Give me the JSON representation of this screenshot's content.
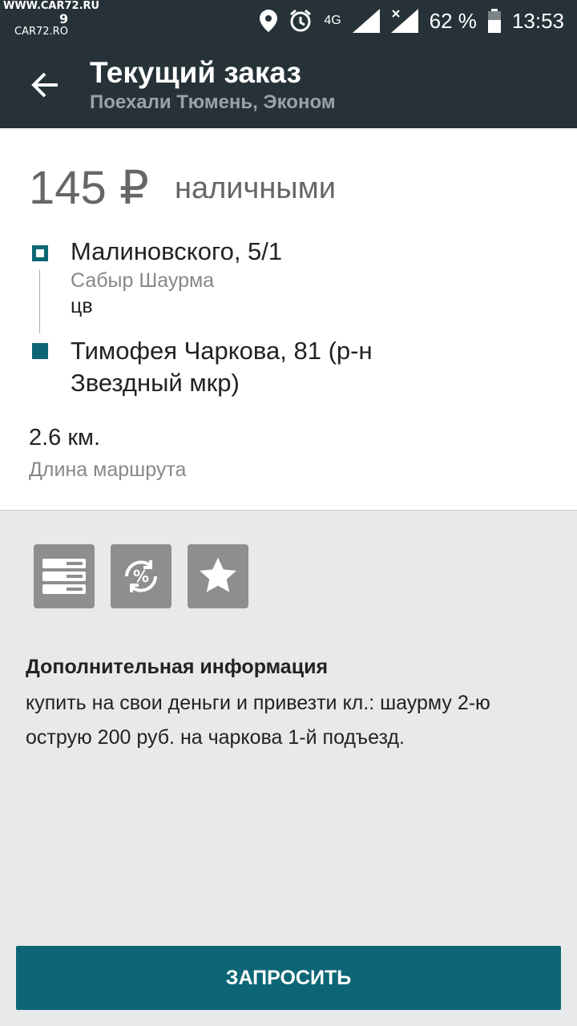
{
  "status_bar": {
    "watermark_site": "WWW.CAR72.RU",
    "watermark_site2": "CAR72.RO",
    "watermark_num": "9",
    "network": "4G",
    "battery": "62 %",
    "time": "13:53"
  },
  "header": {
    "title": "Текущий заказ",
    "subtitle": "Поехали Тюмень, Эконом"
  },
  "order": {
    "price": "145 ₽",
    "payment": "наличными",
    "from": {
      "address": "Малиновского, 5/1",
      "place": "Сабыр Шаурма",
      "note": "цв"
    },
    "to": {
      "address": "Тимофея Чаркова, 81 (р-н Звездный мкр)"
    },
    "distance": "2.6 км.",
    "distance_label": "Длина маршрута"
  },
  "options": [
    {
      "icon": "list-icon"
    },
    {
      "icon": "discount-icon"
    },
    {
      "icon": "star-icon"
    }
  ],
  "info": {
    "heading": "Дополнительная информация",
    "text": "купить на свои деньги и привезти кл.: шаурму 2-ю острую 200 руб. на чаркова 1-й подъезд."
  },
  "action": {
    "label": "ЗАПРОСИТЬ"
  },
  "colors": {
    "header_bg": "#263238",
    "accent": "#0d6675",
    "icon_bg": "#8e8e8e"
  }
}
